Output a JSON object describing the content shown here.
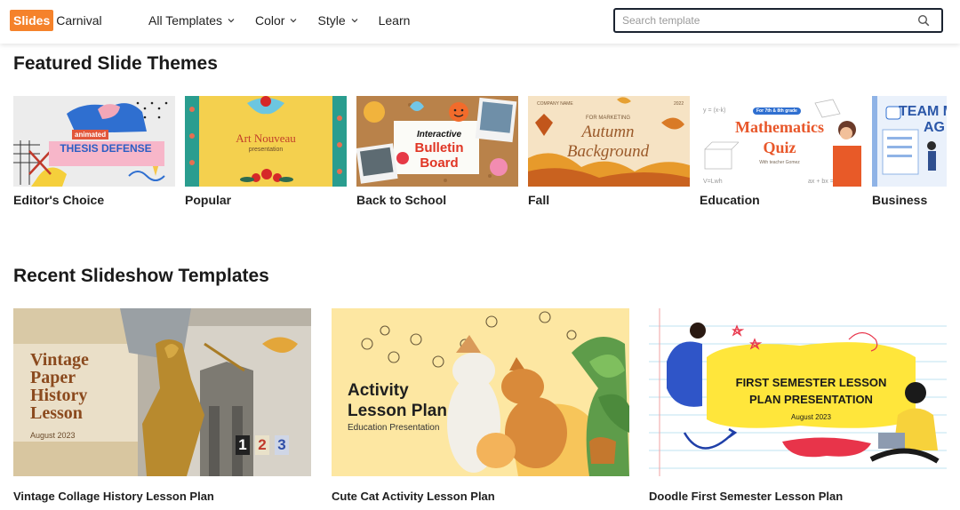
{
  "header": {
    "logo_brand": "Slides",
    "logo_name": "Carnival",
    "nav": [
      {
        "label": "All Templates"
      },
      {
        "label": "Color"
      },
      {
        "label": "Style"
      },
      {
        "label": "Learn"
      }
    ],
    "search_placeholder": "Search template"
  },
  "featured": {
    "title": "Featured Slide Themes",
    "themes": [
      {
        "label": "Editor's Choice",
        "thumb_badge": "animated",
        "thumb_title": "THESIS DEFENSE"
      },
      {
        "label": "Popular",
        "thumb_title": "Art Nouveau",
        "thumb_sub": "presentation"
      },
      {
        "label": "Back to School",
        "thumb_title_top": "Interactive",
        "thumb_title_mid": "Bulletin",
        "thumb_title_bot": "Board"
      },
      {
        "label": "Fall",
        "thumb_company": "COMPANY NAME",
        "thumb_kicker": "FOR MARKETING",
        "thumb_year": "2022",
        "thumb_title_a": "Autumn",
        "thumb_title_b": "Background"
      },
      {
        "label": "Education",
        "thumb_badge": "For 7th & 8th grade",
        "thumb_title_a": "Mathematics",
        "thumb_title_b": "Quiz",
        "thumb_sub": "With teacher Gomez"
      },
      {
        "label": "Business",
        "thumb_title_a": "TEAM M",
        "thumb_title_b": "AG"
      }
    ]
  },
  "recent": {
    "title": "Recent Slideshow Templates",
    "templates": [
      {
        "label": "Vintage Collage History Lesson Plan",
        "thumb_lines": [
          "Vintage",
          "Paper",
          "History",
          "Lesson"
        ],
        "thumb_date": "August 2023",
        "thumb_nums": [
          "1",
          "2",
          "3"
        ]
      },
      {
        "label": "Cute Cat Activity Lesson Plan",
        "thumb_lines": [
          "Activity",
          "Lesson Plan"
        ],
        "thumb_sub": "Education Presentation"
      },
      {
        "label": "Doodle First Semester Lesson Plan",
        "thumb_lines": [
          "FIRST SEMESTER LESSON",
          "PLAN PRESENTATION"
        ],
        "thumb_date": "August 2023"
      }
    ]
  },
  "colors": {
    "brand_orange": "#f5822b",
    "search_border": "#1b2330"
  }
}
